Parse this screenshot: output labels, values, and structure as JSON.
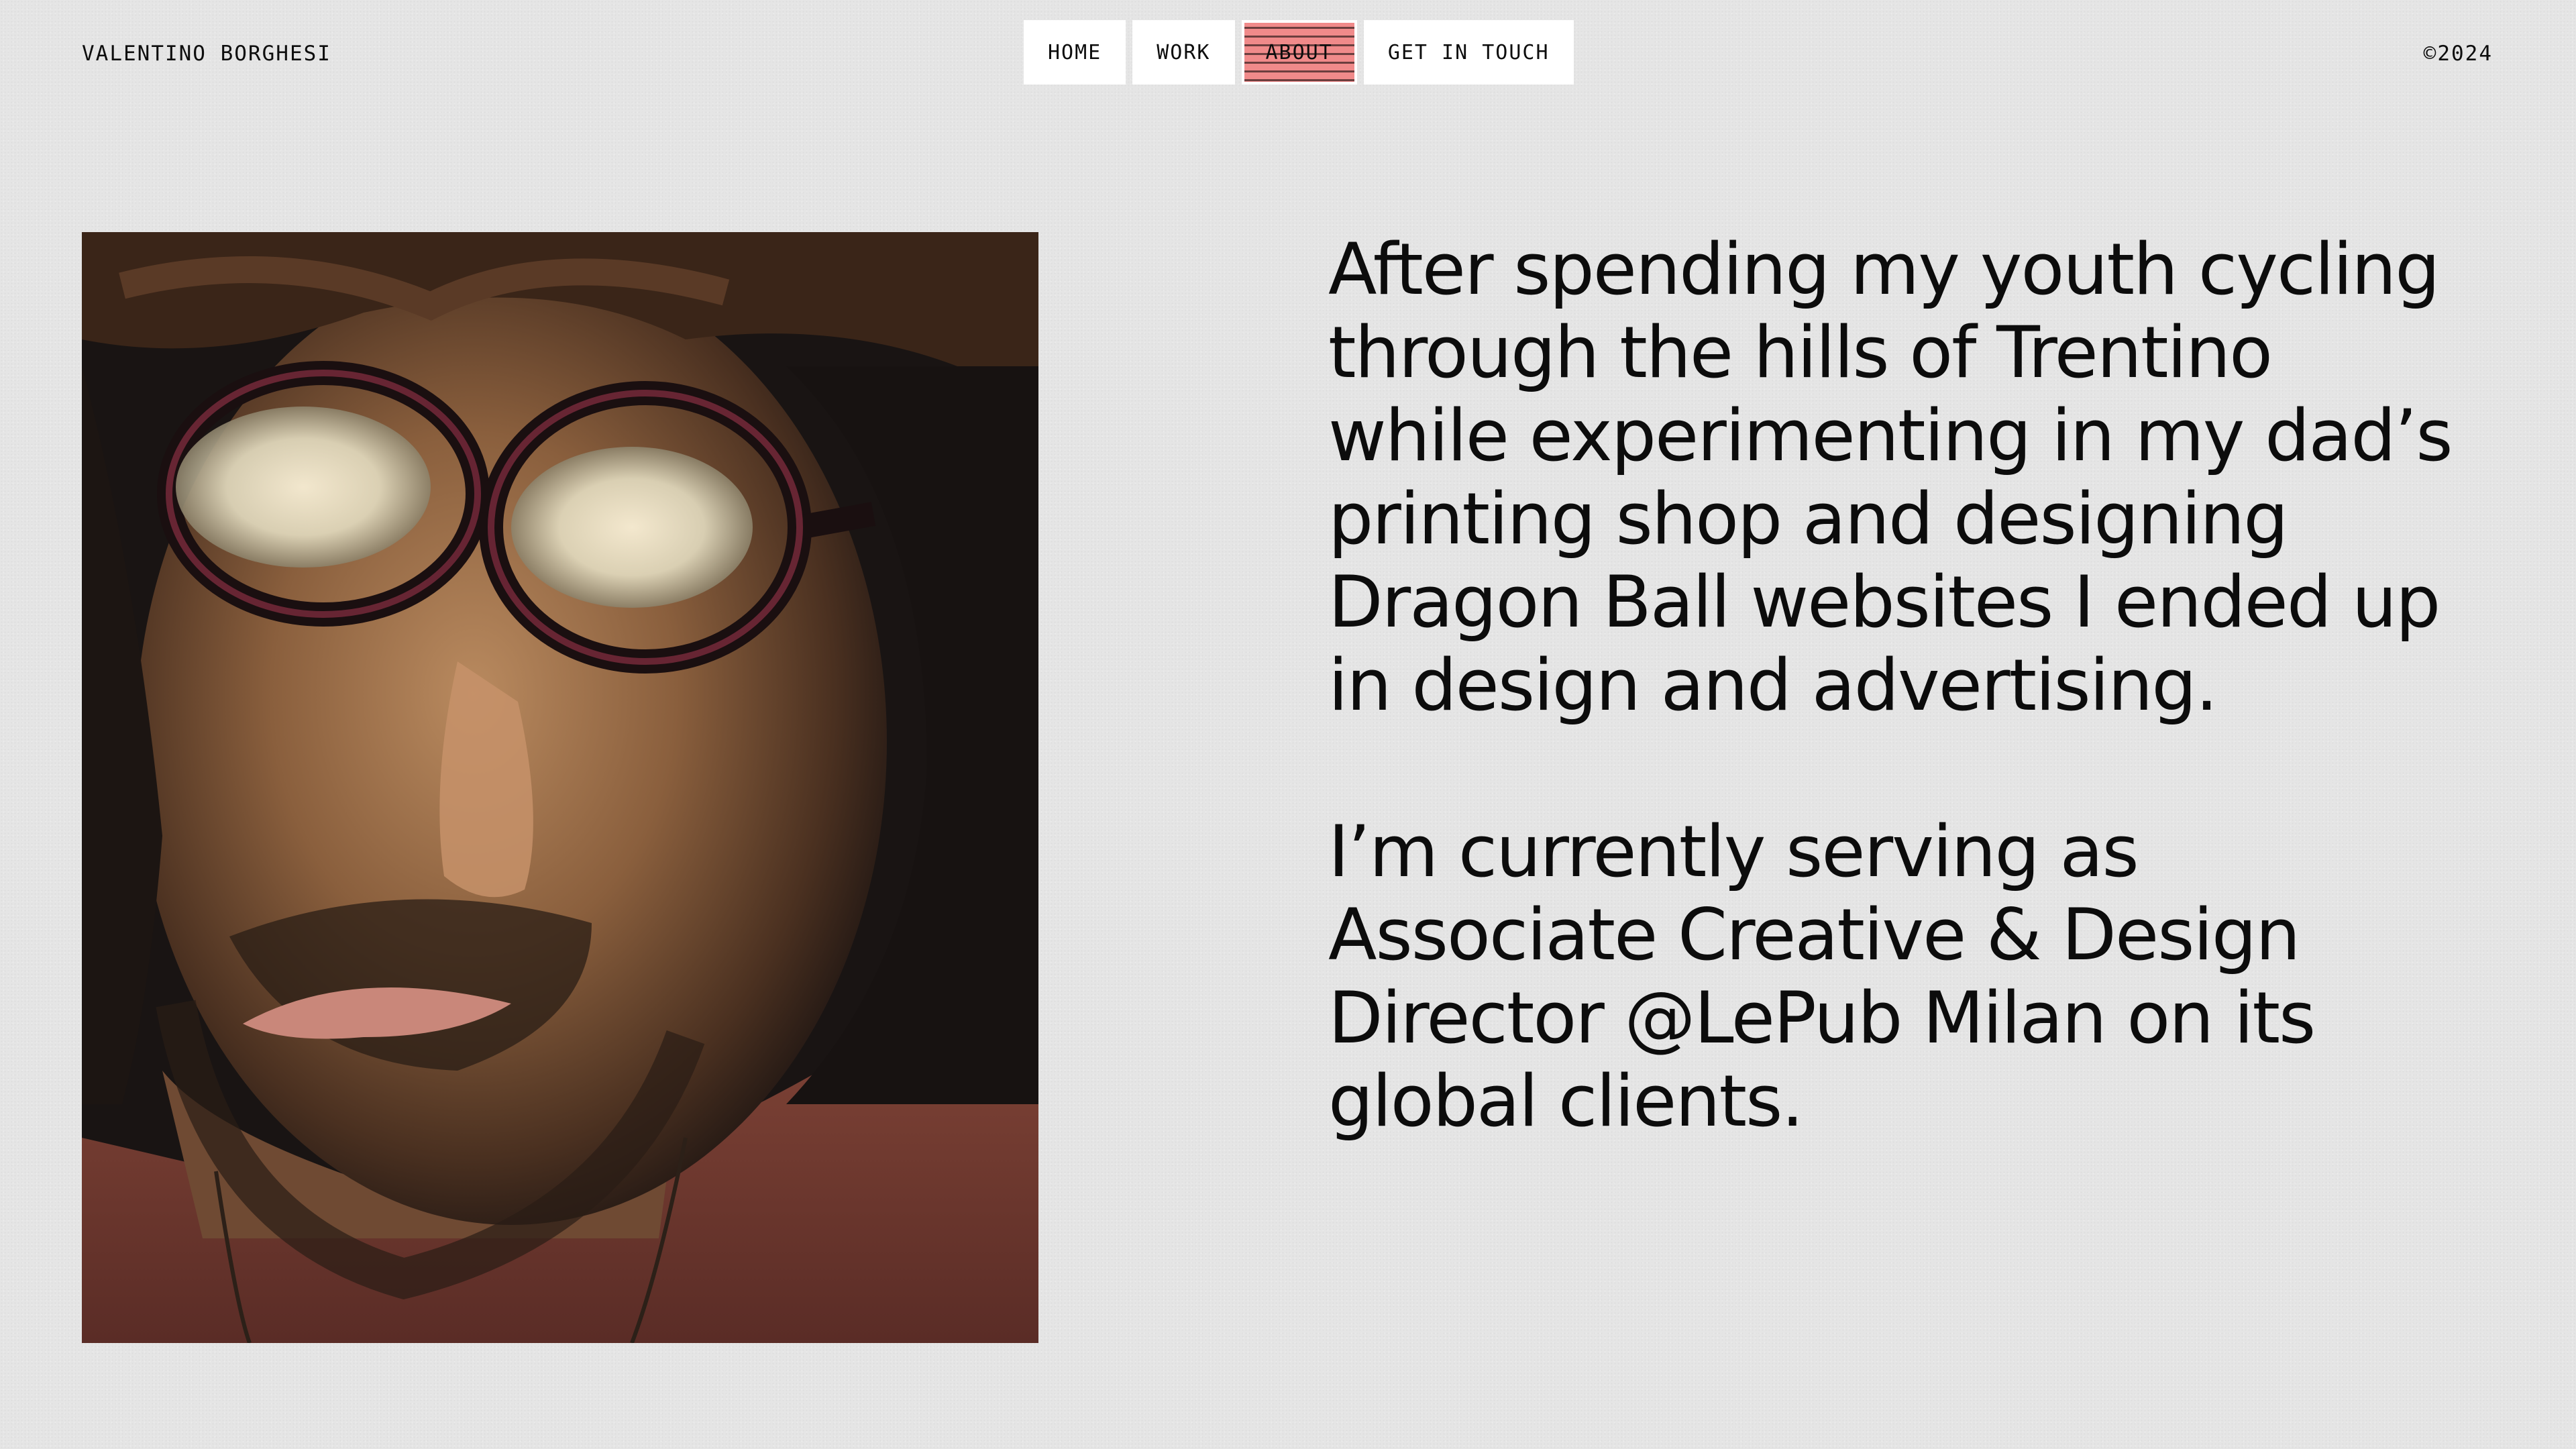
{
  "header": {
    "site_name": "VALENTINO BORGHESI",
    "copyright": "©2024"
  },
  "nav": {
    "items": [
      {
        "label": "HOME"
      },
      {
        "label": "WORK"
      },
      {
        "label": "ABOUT",
        "active": true
      },
      {
        "label": "GET IN TOUCH"
      }
    ]
  },
  "bio": {
    "paragraphs": [
      "After spending my youth cycling through the hills of Trentino while experimenting in my dad’s printing shop and designing Dragon Ball websites I ended up in design and advertising.",
      "I’m currently serving as Associate Creative & Design Director @LePub Milan on its global clients."
    ]
  },
  "colors": {
    "background": "#e5e5e5",
    "nav_button": "#ffffff",
    "nav_active": "#f08a8a",
    "text": "#0d0d0d"
  }
}
